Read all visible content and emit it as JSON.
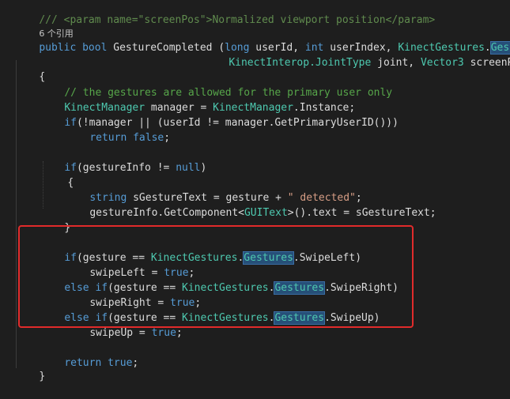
{
  "code": {
    "line_doc_comment": "/// <param name=\"screenPos\">Normalized viewport position</param>",
    "ref_count": "6 个引用",
    "sig1_public": "public",
    "sig1_bool": "bool",
    "sig1_name": "GestureCompleted",
    "sig1_paren": "(",
    "sig1_long": "long",
    "sig1_userId": "userId,",
    "sig1_int": "int",
    "sig1_userIndex": "userIndex,",
    "sig1_kg": "KinectGestures",
    "sig1_dot": ".",
    "sig1_gestu": "Gestu",
    "sig2_ki": "KinectInterop",
    "sig2_jt": ".JointType",
    "sig2_joint": "joint,",
    "sig2_v3": "Vector3",
    "sig2_screen": "screenPos",
    "brace_open": "{",
    "comment_gestures": "// the gestures are allowed for the primary user only",
    "mgr_type": "KinectManager",
    "mgr_decl": "manager =",
    "mgr_type2": "KinectManager",
    "mgr_inst": ".Instance;",
    "if1_if": "if",
    "if1_cond": "(!manager || (userId != manager.GetPrimaryUserID()))",
    "ret1_return": "return",
    "ret1_false": "false",
    "ret1_semi": ";",
    "if2_if": "if",
    "if2_cond": "(gestureInfo !=",
    "if2_null": "null",
    "if2_close": ")",
    "brace_inner_open": "{",
    "str_string": "string",
    "str_decl": "sGestureText = gesture +",
    "str_lit": "\" detected\"",
    "str_semi": ";",
    "gc_call": "gestureInfo.GetComponent<",
    "gc_type": "GUIText",
    "gc_rest": ">().text = sGestureText;",
    "brace_inner_close": "}",
    "sw1_if": "if",
    "sw1_a": "(gesture ==",
    "sw1_kg": "KinectGestures",
    "sw1_g": "Gestures",
    "sw1_b": ".SwipeLeft)",
    "sw1_assign": "swipeLeft =",
    "sw1_true": "true",
    "sw1_semi": ";",
    "sw2_else": "else",
    "sw2_if": "if",
    "sw2_a": "(gesture ==",
    "sw2_kg": "KinectGestures",
    "sw2_g": "Gestures",
    "sw2_b": ".SwipeRight)",
    "sw2_assign": "swipeRight =",
    "sw2_true": "true",
    "sw2_semi": ";",
    "sw3_else": "else",
    "sw3_if": "if",
    "sw3_a": "(gesture ==",
    "sw3_kg": "KinectGestures",
    "sw3_g": "Gestures",
    "sw3_b": ".SwipeUp)",
    "sw3_assign": "swipeUp =",
    "sw3_true": "true",
    "sw3_semi": ";",
    "ret2_return": "return",
    "ret2_true": "true",
    "ret2_semi": ";",
    "brace_close": "}"
  },
  "colors": {
    "background": "#1e1e1e",
    "keyword": "#569cd6",
    "type": "#4ec9b0",
    "comment": "#57a64a",
    "string": "#d69d85",
    "highlight_box": "#e12b2b"
  }
}
